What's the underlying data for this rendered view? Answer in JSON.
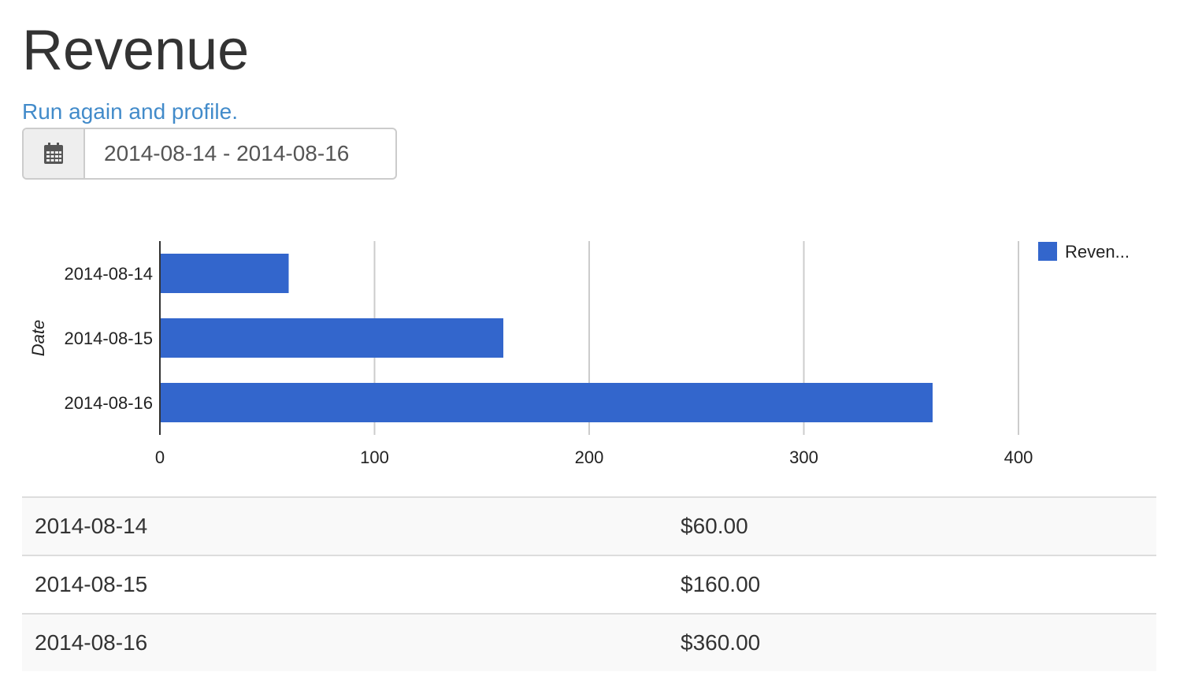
{
  "page": {
    "title": "Revenue",
    "profile_link": "Run again and profile."
  },
  "date_range": {
    "icon": "calendar-icon",
    "value": "2014-08-14 - 2014-08-16"
  },
  "colors": {
    "bar": "#3366cc",
    "link": "#428bca",
    "grid": "#cccccc"
  },
  "chart_data": {
    "type": "bar",
    "orientation": "horizontal",
    "categories": [
      "2014-08-14",
      "2014-08-15",
      "2014-08-16"
    ],
    "series": [
      {
        "name": "Reven...",
        "values": [
          60,
          160,
          360
        ]
      }
    ],
    "title": "",
    "xlabel": "",
    "ylabel": "Date",
    "xlim": [
      0,
      400
    ],
    "xticks": [
      0,
      100,
      200,
      300,
      400
    ],
    "grid": true,
    "legend": "top-right"
  },
  "table": {
    "rows": [
      {
        "date": "2014-08-14",
        "amount": "$60.00"
      },
      {
        "date": "2014-08-15",
        "amount": "$160.00"
      },
      {
        "date": "2014-08-16",
        "amount": "$360.00"
      }
    ]
  }
}
